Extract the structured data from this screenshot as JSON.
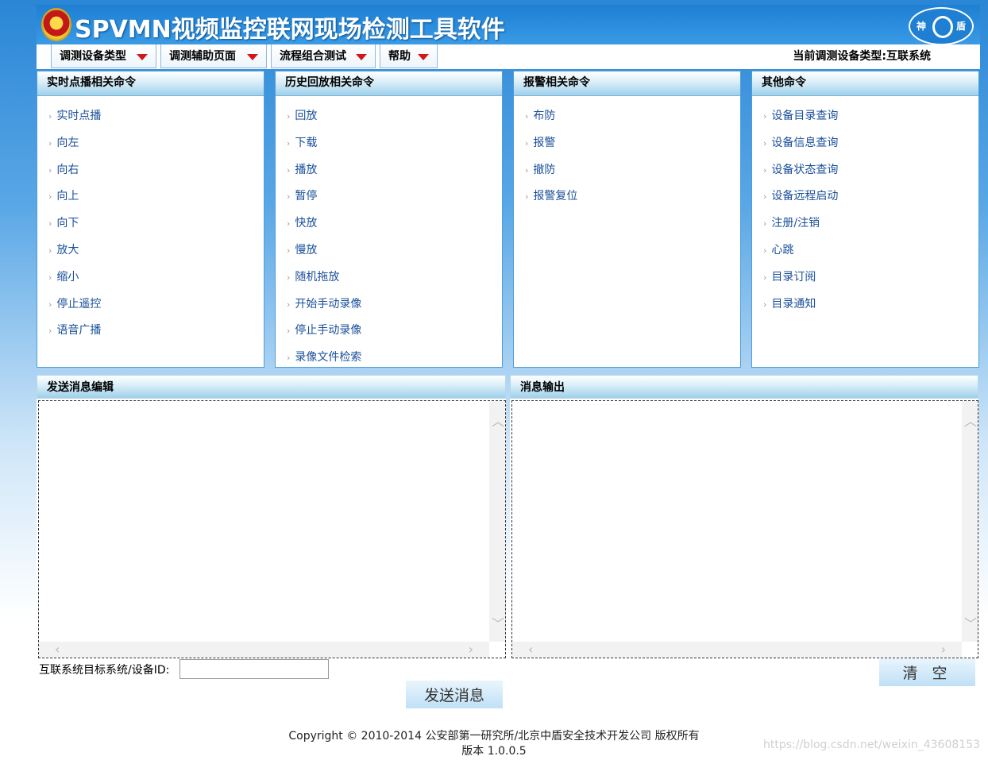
{
  "header": {
    "title": "SPVMN视频监控联网现场检测工具软件",
    "logo_text_left": "神",
    "logo_text_right": "盾"
  },
  "menubar": {
    "menus": [
      {
        "label": "调测设备类型"
      },
      {
        "label": "调测辅助页面"
      },
      {
        "label": "流程组合测试"
      },
      {
        "label": "帮助"
      }
    ],
    "device_type": "当前调测设备类型:互联系统"
  },
  "panels": [
    {
      "title": "实时点播相关命令",
      "items": [
        "实时点播",
        "向左",
        "向右",
        "向上",
        "向下",
        "放大",
        "缩小",
        "停止遥控",
        "语音广播"
      ]
    },
    {
      "title": "历史回放相关命令",
      "items": [
        "回放",
        "下载",
        "播放",
        "暂停",
        "快放",
        "慢放",
        "随机拖放",
        "开始手动录像",
        "停止手动录像",
        "录像文件检索"
      ]
    },
    {
      "title": "报警相关命令",
      "items": [
        "布防",
        "报警",
        "撤防",
        "报警复位"
      ]
    },
    {
      "title": "其他命令",
      "items": [
        "设备目录查询",
        "设备信息查询",
        "设备状态查询",
        "设备远程启动",
        "注册/注销",
        "心跳",
        "目录订阅",
        "目录通知"
      ]
    }
  ],
  "send_editor": {
    "title": "发送消息编辑"
  },
  "output": {
    "title": "消息输出"
  },
  "target": {
    "label": "互联系统目标系统/设备ID:",
    "value": ""
  },
  "buttons": {
    "send": "发送消息",
    "clear": "清空"
  },
  "footer": {
    "copyright": "Copyright © 2010-2014 公安部第一研究所/北京中盾安全技术开发公司 版权所有",
    "version": "版本 1.0.0.5"
  },
  "watermark": "https://blog.csdn.net/weixin_43608153",
  "colors": {
    "header_blue": "#1f7fd2",
    "link_blue": "#1a4f9a",
    "menu_arrow": "#d11717"
  }
}
